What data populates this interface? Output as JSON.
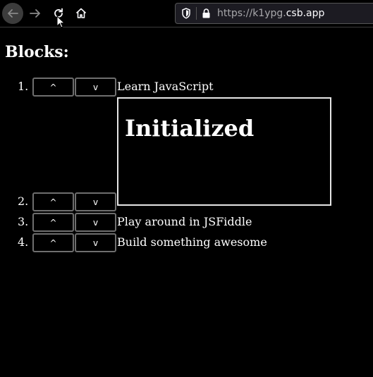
{
  "browser": {
    "url_scheme": "https://",
    "url_subdomain": "k1ypg.",
    "url_domain": "csb.app"
  },
  "page": {
    "heading": "Blocks:",
    "items": [
      {
        "number": "1.",
        "up_label": "^",
        "down_label": "v",
        "text": "Learn JavaScript"
      },
      {
        "number": "2.",
        "up_label": "^",
        "down_label": "v",
        "text": ""
      },
      {
        "number": "3.",
        "up_label": "^",
        "down_label": "v",
        "text": "Play around in JSFiddle"
      },
      {
        "number": "4.",
        "up_label": "^",
        "down_label": "v",
        "text": "Build something awesome"
      }
    ],
    "block_title": "Initialized"
  },
  "icons": {
    "back": "arrow-left-icon",
    "forward": "arrow-right-icon",
    "reload": "reload-icon",
    "home": "home-icon",
    "tracking": "shield-icon",
    "secure": "lock-icon"
  },
  "colors": {
    "background": "#000000",
    "text": "#ffffff",
    "button_border": "#6e6e6e",
    "box_border": "#e6e6e6"
  }
}
